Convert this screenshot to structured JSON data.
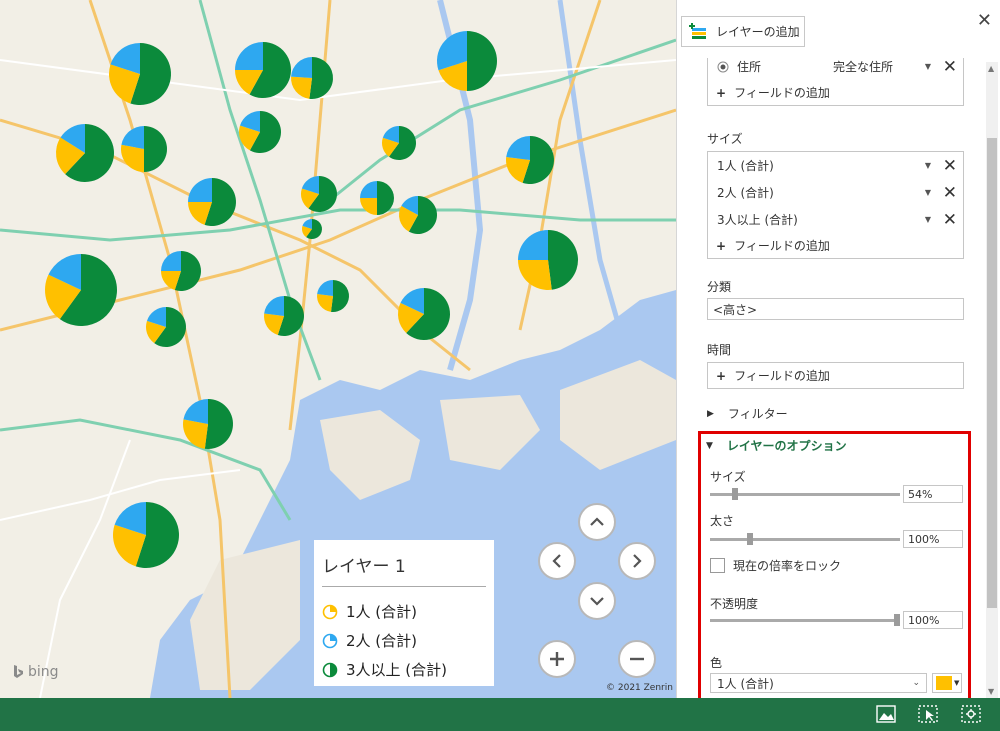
{
  "map": {
    "attribution": "bing",
    "copyright": "© 2021 Zenrin",
    "colors": {
      "slice1": "#ffc000",
      "slice2": "#2ea8f0",
      "slice3": "#0b8a3b",
      "water": "#aac8f0",
      "land": "#f2efe6"
    },
    "pies": [
      {
        "label": "p1",
        "values": [
          0.55,
          0.25,
          0.2
        ]
      },
      {
        "label": "p2",
        "values": [
          0.58,
          0.17,
          0.25
        ]
      },
      {
        "label": "p3",
        "values": [
          0.52,
          0.24,
          0.24
        ]
      },
      {
        "label": "p4",
        "values": [
          0.5,
          0.2,
          0.3
        ]
      },
      {
        "label": "p5",
        "values": [
          0.62,
          0.22,
          0.16
        ]
      },
      {
        "label": "p6",
        "values": [
          0.5,
          0.28,
          0.22
        ]
      },
      {
        "label": "p7",
        "values": [
          0.58,
          0.22,
          0.2
        ]
      },
      {
        "label": "p8",
        "values": [
          0.6,
          0.2,
          0.2
        ]
      },
      {
        "label": "p9",
        "values": [
          0.55,
          0.22,
          0.23
        ]
      },
      {
        "label": "p10",
        "values": [
          0.55,
          0.2,
          0.25
        ]
      },
      {
        "label": "p11",
        "values": [
          0.6,
          0.2,
          0.2
        ]
      },
      {
        "label": "p12",
        "values": [
          0.5,
          0.25,
          0.25
        ]
      },
      {
        "label": "p13",
        "values": [
          0.58,
          0.25,
          0.17
        ]
      },
      {
        "label": "p14",
        "values": [
          0.6,
          0.2,
          0.2
        ]
      },
      {
        "label": "p15",
        "values": [
          0.48,
          0.27,
          0.25
        ]
      },
      {
        "label": "p16",
        "values": [
          0.55,
          0.2,
          0.25
        ]
      },
      {
        "label": "p17",
        "values": [
          0.6,
          0.22,
          0.18
        ]
      },
      {
        "label": "p18",
        "values": [
          0.6,
          0.2,
          0.2
        ]
      },
      {
        "label": "p19",
        "values": [
          0.55,
          0.22,
          0.23
        ]
      },
      {
        "label": "p20",
        "values": [
          0.52,
          0.25,
          0.23
        ]
      },
      {
        "label": "p21",
        "values": [
          0.62,
          0.2,
          0.18
        ]
      },
      {
        "label": "p22",
        "values": [
          0.52,
          0.26,
          0.22
        ]
      }
    ]
  },
  "legend": {
    "title": "レイヤー 1",
    "items": [
      "1人 (合計)",
      "2人 (合計)",
      "3人以上 (合計)"
    ]
  },
  "panel": {
    "add_layer": "レイヤーの追加",
    "location": {
      "field": "住所",
      "type": "完全な住所",
      "add": "フィールドの追加"
    },
    "size": {
      "label": "サイズ",
      "fields": [
        "1人 (合計)",
        "2人 (合計)",
        "3人以上 (合計)"
      ],
      "add": "フィールドの追加"
    },
    "category": {
      "label": "分類",
      "value": "<高さ>"
    },
    "time": {
      "label": "時間",
      "add": "フィールドの追加"
    },
    "filter": {
      "label": "フィルター"
    },
    "options": {
      "label": "レイヤーのオプション",
      "size_label": "サイズ",
      "size_value": "54%",
      "size_level": 0.12,
      "thickness_label": "太さ",
      "thickness_value": "100%",
      "thickness_level": 0.2,
      "lock_label": "現在の倍率をロック",
      "opacity_label": "不透明度",
      "opacity_value": "100%",
      "opacity_level": 1.0,
      "color_label": "色",
      "color_select": "1人 (合計)",
      "color_swatch": "#ffc000"
    }
  }
}
